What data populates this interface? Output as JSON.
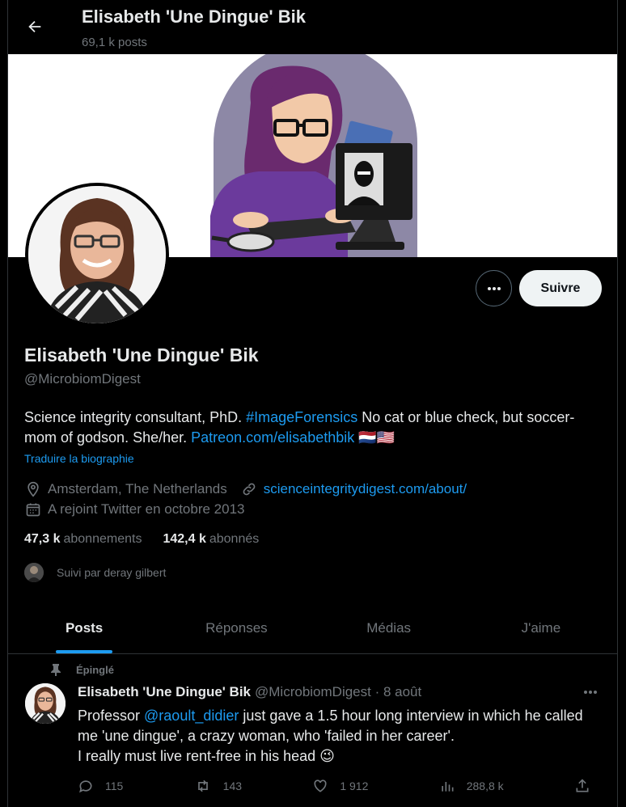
{
  "header": {
    "title": "Elisabeth 'Une Dingue' Bik",
    "post_count": "69,1 k posts"
  },
  "profile": {
    "name": "Elisabeth 'Une Dingue' Bik",
    "handle": "@MicrobiomDigest",
    "follow_label": "Suivre",
    "bio": {
      "part1": "Science integrity consultant, PhD. ",
      "hashtag": "#ImageForensics",
      "part2": " No cat or blue check, but soccer-mom of godson. She/her. ",
      "link": "Patreon.com/elisabethbik",
      "flags": "🇳🇱🇺🇸"
    },
    "translate_label": "Traduire la biographie",
    "location": "Amsterdam, The Netherlands",
    "website": "scienceintegritydigest.com/about/",
    "joined": "A rejoint Twitter en octobre 2013",
    "following_count": "47,3 k",
    "following_label": "abonnements",
    "followers_count": "142,4 k",
    "followers_label": "abonnés",
    "followed_by": "Suivi par deray gilbert"
  },
  "tabs": [
    {
      "label": "Posts",
      "active": true
    },
    {
      "label": "Réponses",
      "active": false
    },
    {
      "label": "Médias",
      "active": false
    },
    {
      "label": "J'aime",
      "active": false
    }
  ],
  "pinned_post": {
    "pinned_label": "Épinglé",
    "author_name": "Elisabeth 'Une Dingue' Bik",
    "author_handle_date": "@MicrobiomDigest · 8 août",
    "text_prefix": "Professor ",
    "mention": "@raoult_didier",
    "text_line1_rest": " just gave a 1.5 hour long interview in which he called me 'une dingue', a crazy woman, who 'failed in her career'.",
    "text_line2": "I really must live rent-free in his head 😉",
    "replies": "115",
    "reposts": "143",
    "likes": "1 912",
    "views": "288,8 k"
  },
  "colors": {
    "accent": "#1d9bf0",
    "background": "#000000",
    "muted": "#71767b",
    "text": "#e7e9ea"
  }
}
